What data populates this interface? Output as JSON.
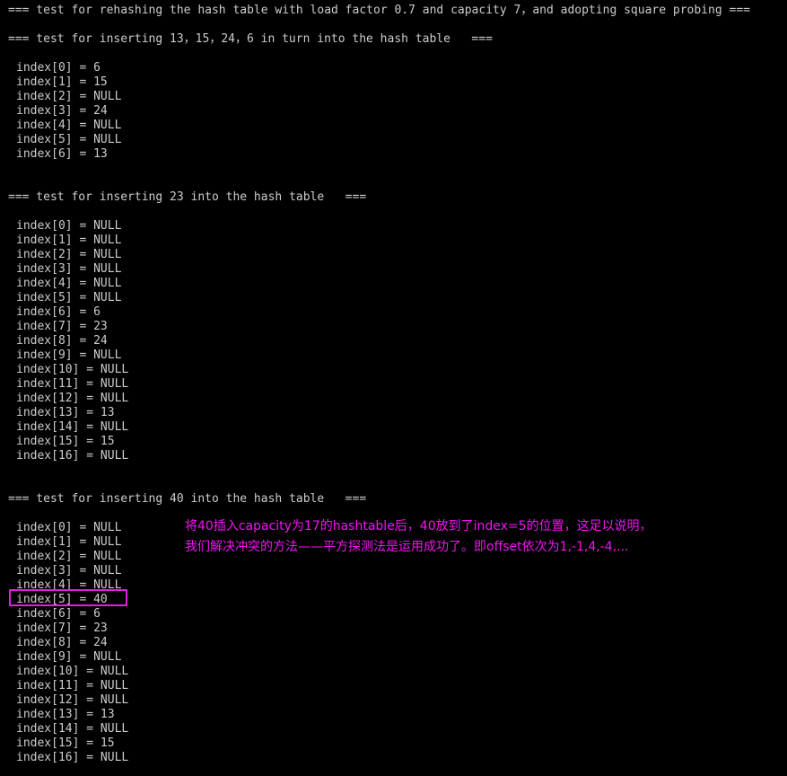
{
  "terminal": {
    "background_color": "#000000",
    "text_color": "#cccccc",
    "accent_color": "#f412f4",
    "highlight_border_color": "#e020e0"
  },
  "headers": {
    "rehash": "=== test for rehashing the hash table with load factor 0.7 and capacity 7，and adopting square probing ===",
    "insert_batch": "=== test for inserting 13，15，24，6 in turn into the hash table   ===",
    "insert_23": "=== test for inserting 23 into the hash table   ===",
    "insert_40": "=== test for inserting 40 into the hash table   ==="
  },
  "blocks": {
    "block1": [
      "index[0] = 6",
      "index[1] = 15",
      "index[2] = NULL",
      "index[3] = 24",
      "index[4] = NULL",
      "index[5] = NULL",
      "index[6] = 13"
    ],
    "block2": [
      "index[0] = NULL",
      "index[1] = NULL",
      "index[2] = NULL",
      "index[3] = NULL",
      "index[4] = NULL",
      "index[5] = NULL",
      "index[6] = 6",
      "index[7] = 23",
      "index[8] = 24",
      "index[9] = NULL",
      "index[10] = NULL",
      "index[11] = NULL",
      "index[12] = NULL",
      "index[13] = 13",
      "index[14] = NULL",
      "index[15] = 15",
      "index[16] = NULL"
    ],
    "block3": [
      "index[0] = NULL",
      "index[1] = NULL",
      "index[2] = NULL",
      "index[3] = NULL",
      "index[4] = NULL",
      "index[5] = 40",
      "index[6] = 6",
      "index[7] = 23",
      "index[8] = 24",
      "index[9] = NULL",
      "index[10] = NULL",
      "index[11] = NULL",
      "index[12] = NULL",
      "index[13] = 13",
      "index[14] = NULL",
      "index[15] = 15",
      "index[16] = NULL"
    ]
  },
  "annotation": {
    "line1": "将40插入capacity为17的hashtable后，40放到了index=5的位置，这足以说明，",
    "line2": "我们解决冲突的方法——平方探测法是运用成功了。即offset依次为1,-1,4,-4,..."
  }
}
